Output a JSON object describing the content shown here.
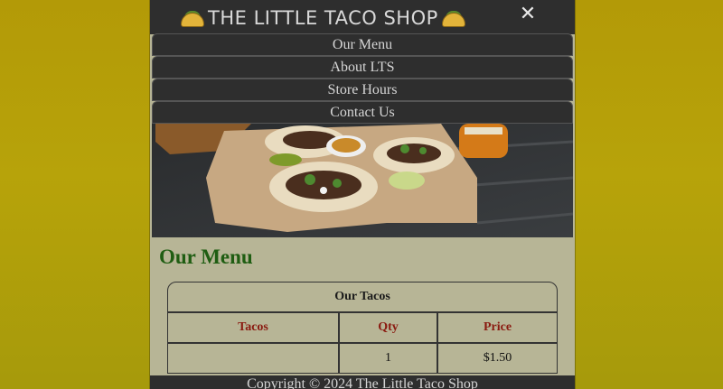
{
  "header": {
    "title": "THE LITTLE TACO SHOP",
    "left_icon": "taco-icon",
    "right_icon": "taco-icon",
    "close_icon": "close-icon",
    "close_glyph": "✕"
  },
  "nav": {
    "items": [
      {
        "label": "Our Menu"
      },
      {
        "label": "About LTS"
      },
      {
        "label": "Store Hours"
      },
      {
        "label": "Contact Us"
      }
    ]
  },
  "hero": {
    "alt": "Tacos on a tray"
  },
  "main": {
    "heading": "Our Menu",
    "table": {
      "caption": "Our Tacos",
      "headers": [
        "Tacos",
        "Qty",
        "Price"
      ],
      "rows": [
        {
          "taco": "",
          "qty": "1",
          "price": "$1.50"
        }
      ]
    }
  },
  "footer": {
    "text": "Copyright © 2024 The Little Taco Shop"
  },
  "colors": {
    "page_bg": "#b39a07",
    "panel_bg": "#b7b596",
    "bar_bg": "#2e2e2e",
    "heading": "#1f5d12",
    "table_header": "#8a1a10"
  }
}
